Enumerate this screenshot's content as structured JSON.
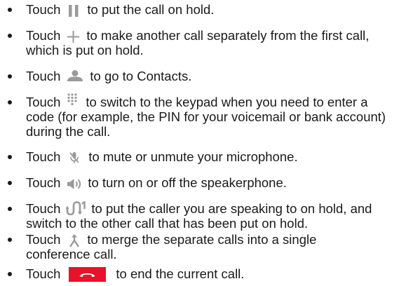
{
  "items": [
    {
      "icon": "pause-icon",
      "before": "Touch",
      "lines": [
        "to put the call on hold."
      ]
    },
    {
      "icon": "plus-icon",
      "before": "Touch",
      "lines": [
        "to make another call separately from the first call,",
        "which is put on hold."
      ]
    },
    {
      "icon": "contact-person-icon",
      "before": "Touch",
      "lines": [
        "to go to Contacts."
      ]
    },
    {
      "icon": "dialpad-icon",
      "before": "Touch",
      "lines": [
        "to switch to the keypad when you need to enter a",
        "code (for example, the PIN for your voicemail or bank account)",
        "during the call."
      ]
    },
    {
      "icon": "mic-off-icon",
      "before": "Touch",
      "lines": [
        "to mute or unmute your microphone."
      ]
    },
    {
      "icon": "speaker-icon",
      "before": "Touch",
      "lines": [
        "to turn on or off the speakerphone."
      ]
    },
    {
      "icon": "swap-calls-icon",
      "before": "Touch",
      "lines": [
        "to put the caller you are speaking to on hold, and",
        "switch to the other call that has been put on hold."
      ]
    },
    {
      "icon": "merge-calls-icon",
      "before": "Touch",
      "lines": [
        "to merge the separate calls into a single",
        "conference call."
      ]
    },
    {
      "icon": "end-call-icon",
      "before": "Touch",
      "lines": [
        "to end the current call."
      ]
    }
  ],
  "colors": {
    "text": "#1a1a1a",
    "icon_gray": "#9a9a9a",
    "end_call_red": "#e8122a"
  }
}
